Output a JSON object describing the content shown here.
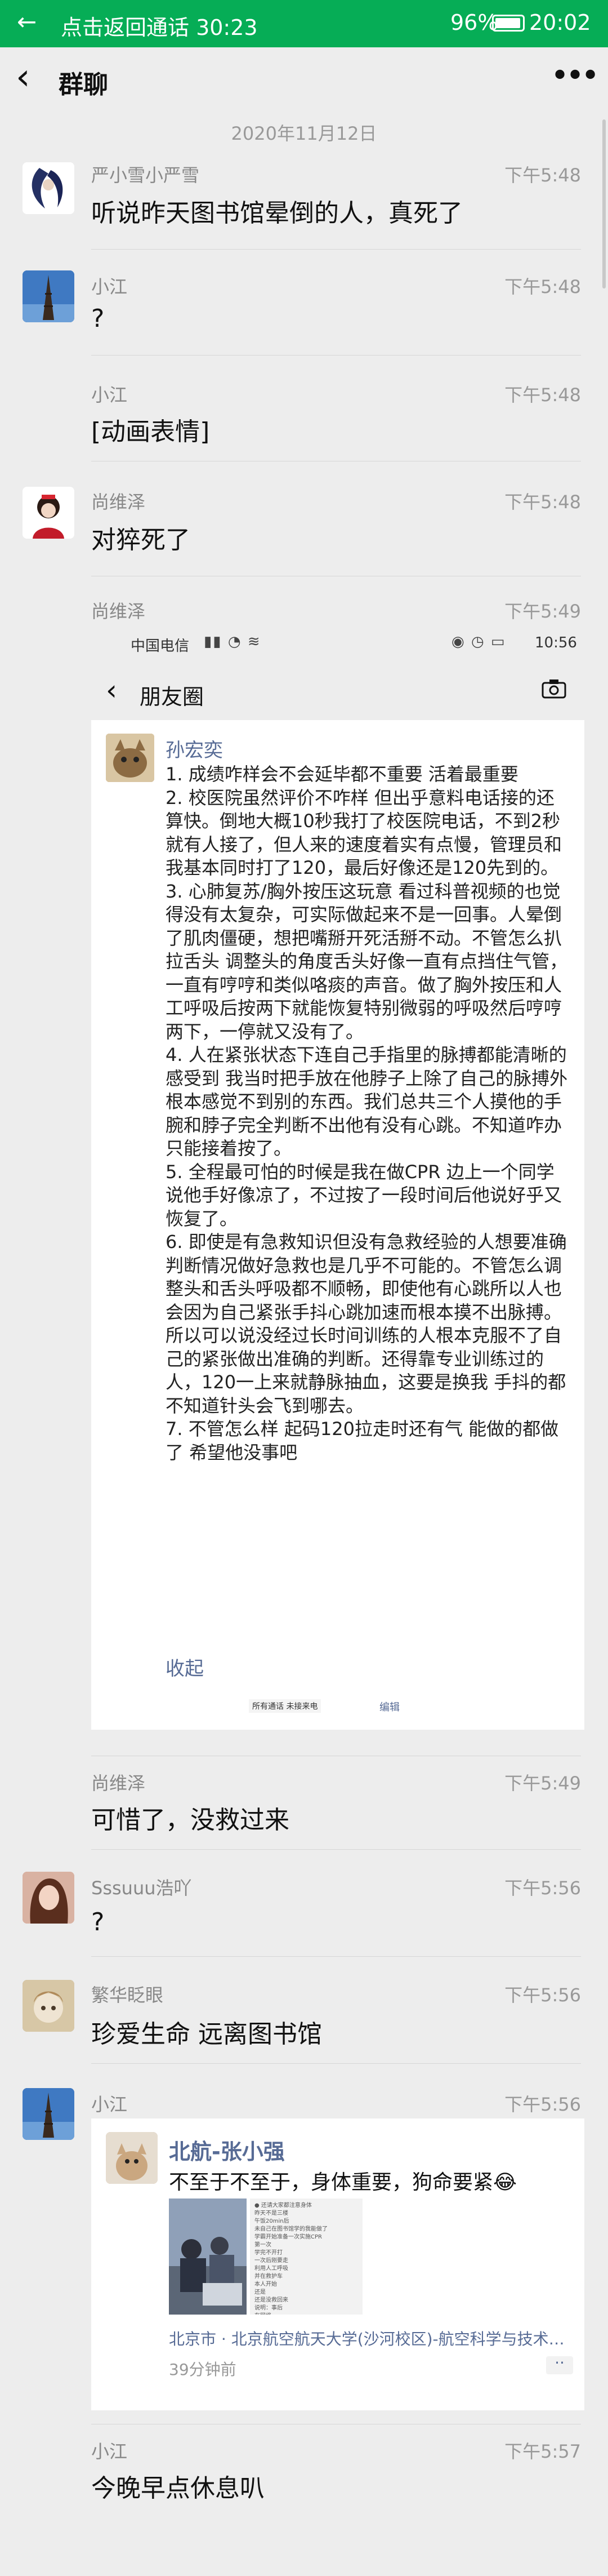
{
  "status_bar": {
    "back_call": "点击返回通话 30:23",
    "battery": "96%",
    "battery_level": 0.96,
    "time": "20:02"
  },
  "header": {
    "title": "群聊"
  },
  "date_divider": "2020年11月12日",
  "messages": [
    {
      "name": "严小雪小严雪",
      "time": "下午5:48",
      "text": "听说昨天图书馆晕倒的人，真死了"
    },
    {
      "name": "小江",
      "time": "下午5:48",
      "text": "?"
    },
    {
      "name": "小江",
      "time": "下午5:48",
      "text": "[动画表情]"
    },
    {
      "name": "尚维泽",
      "time": "下午5:48",
      "text": "对猝死了"
    },
    {
      "name": "尚维泽",
      "time": "下午5:49"
    },
    {
      "name": "尚维泽",
      "time": "下午5:49",
      "text": "可惜了，没救过来"
    },
    {
      "name": "Sssuuu浩吖",
      "time": "下午5:56",
      "text": "?"
    },
    {
      "name": "繁华眨眼",
      "time": "下午5:56",
      "text": "珍爱生命 远离图书馆"
    },
    {
      "name": "小江",
      "time": "下午5:56"
    },
    {
      "name": "小江",
      "time": "下午5:57",
      "text": "今晚早点休息叭"
    }
  ],
  "screenshot": {
    "status": {
      "operator": "中国电信",
      "time": "10:56"
    },
    "nav_title": "朋友圈",
    "poster": "孙宏奕",
    "paragraphs": [
      "1. 成绩咋样会不会延毕都不重要 活着最重要",
      "2. 校医院虽然评价不咋样 但出乎意料电话接的还算快。倒地大概10秒我打了校医院电话，不到2秒就有人接了，但人来的速度着实有点慢，管理员和我基本同时打了120，最后好像还是120先到的。",
      "3. 心肺复苏/胸外按压这玩意 看过科普视频的也觉得没有太复杂，可实际做起来不是一回事。人晕倒了肌肉僵硬，想把嘴掰开死活掰不动。不管怎么扒拉舌头 调整头的角度舌头好像一直有点挡住气管，一直有哼哼和类似咯痰的声音。做了胸外按压和人工呼吸后按两下就能恢复特别微弱的呼吸然后哼哼两下，一停就又没有了。",
      "4. 人在紧张状态下连自己手指里的脉搏都能清晰的感受到 我当时把手放在他脖子上除了自己的脉搏外根本感觉不到别的东西。我们总共三个人摸他的手腕和脖子完全判断不出他有没有心跳。不知道咋办只能接着按了。",
      "5. 全程最可怕的时候是我在做CPR 边上一个同学说他手好像凉了，不过按了一段时间后他说好乎又恢复了。",
      "6. 即使是有急救知识但没有急救经验的人想要准确判断情况做好急救也是几乎不可能的。不管怎么调整头和舌头呼吸都不顺畅，即使他有心跳所以人也会因为自己紧张手抖心跳加速而根本摸不出脉搏。所以可以说没经过长时间训练的人根本克服不了自己的紧张做出准确的判断。还得靠专业训练过的人，120一上来就静脉抽血，这要是换我 手抖的都不知道针头会飞到哪去。",
      "7. 不管怎么样 起码120拉走时还有气 能做的都做了 希望他没事吧"
    ],
    "fold": "收起",
    "tabs": "所有通话  未接来电",
    "edit": "编辑"
  },
  "shared_moment": {
    "poster": "北航-张小强",
    "text": "不至于不至于，身体重要，狗命要紧😂",
    "doc_lines": [
      "● 还请大家都注意身体",
      "昨天不是三楼",
      "午饭20min后",
      "未自己在图书馆学的我能做了",
      "学霸开始准备一次实施CPR",
      "第一次",
      "学完不开打",
      "一次后刚要走",
      "利用人工呼吸",
      "并在救护车",
      "本人开始",
      "还是",
      "还是没救回来",
      "说明：事后",
      "在网络"
    ],
    "location": "北京市 · 北京航空航天大学(沙河校区)-航空科学与技术国家实验室",
    "ago": "39分钟前",
    "more": "··"
  },
  "colors": {
    "status_green": "#06ad56",
    "link_blue": "#576b95",
    "background": "#ededed"
  }
}
